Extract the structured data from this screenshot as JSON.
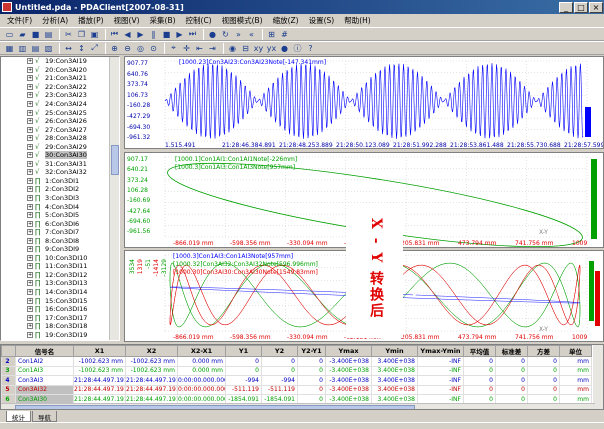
{
  "window": {
    "title": "Untitled.pda - PDAClient[2007-08-31]",
    "min": "_",
    "max": "□",
    "close": "×"
  },
  "menu": [
    "文件(F)",
    "分析(A)",
    "播放(P)",
    "视图(V)",
    "采集(B)",
    "控制(C)",
    "视图模式(B)",
    "缩放(Z)",
    "设置(S)",
    "帮助(H)"
  ],
  "tree": [
    {
      "label": "19:Con3AI19",
      "type": "analog"
    },
    {
      "label": "20:Con3AI20",
      "type": "analog"
    },
    {
      "label": "21:Con3AI21",
      "type": "analog"
    },
    {
      "label": "22:Con3AI22",
      "type": "analog"
    },
    {
      "label": "23:Con3AI23",
      "type": "analog"
    },
    {
      "label": "24:Con3AI24",
      "type": "analog"
    },
    {
      "label": "25:Con3AI25",
      "type": "analog"
    },
    {
      "label": "26:Con3AI26",
      "type": "analog"
    },
    {
      "label": "27:Con3AI27",
      "type": "analog"
    },
    {
      "label": "28:Con3AI28",
      "type": "analog"
    },
    {
      "label": "29:Con3AI29",
      "type": "analog"
    },
    {
      "label": "30:Con3AI30",
      "type": "analog",
      "selected": true
    },
    {
      "label": "31:Con3AI31",
      "type": "analog"
    },
    {
      "label": "32:Con3AI32",
      "type": "analog"
    },
    {
      "label": "1:Con3DI1",
      "type": "digital"
    },
    {
      "label": "2:Con3DI2",
      "type": "digital"
    },
    {
      "label": "3:Con3DI3",
      "type": "digital"
    },
    {
      "label": "4:Con3DI4",
      "type": "digital"
    },
    {
      "label": "5:Con3DI5",
      "type": "digital"
    },
    {
      "label": "6:Con3DI6",
      "type": "digital"
    },
    {
      "label": "7:Con3DI7",
      "type": "digital"
    },
    {
      "label": "8:Con3DI8",
      "type": "digital"
    },
    {
      "label": "9:Con3DI9",
      "type": "digital"
    },
    {
      "label": "10:Con3DI10",
      "type": "digital"
    },
    {
      "label": "11:Con3DI11",
      "type": "digital"
    },
    {
      "label": "12:Con3DI12",
      "type": "digital"
    },
    {
      "label": "13:Con3DI13",
      "type": "digital"
    },
    {
      "label": "14:Con3DI14",
      "type": "digital"
    },
    {
      "label": "15:Con3DI15",
      "type": "digital"
    },
    {
      "label": "16:Con3DI16",
      "type": "digital"
    },
    {
      "label": "17:Con3DI17",
      "type": "digital"
    },
    {
      "label": "18:Con3DI18",
      "type": "digital"
    },
    {
      "label": "19:Con3DI19",
      "type": "digital"
    }
  ],
  "panel1": {
    "legend": "[1000.23]Con3AI23:Con3AI23Note[-147.341mm]",
    "yticks": [
      "907.77",
      "640.76",
      "373.74",
      "106.73",
      "-160.28",
      "-427.29",
      "-694.30",
      "-961.32"
    ],
    "xticks": [
      "1.515.491",
      "21:28:46.384.891",
      "21:28:48.253.889",
      "21:28:50.123.089",
      "21:28:51.992.288",
      "21:28:53.861.488",
      "21:28:55.730.688",
      "21:28:57.599.888"
    ]
  },
  "panel2": {
    "legend1": "[1000.1]Con1AI1:Con1AI1Note[-226mm]",
    "legend2": "[1000.3]Con1AI3:Con1AI3Note[957mm]",
    "yticks": [
      "907.17",
      "640.21",
      "373.24",
      "106.28",
      "-160.69",
      "-427.64",
      "-694.60",
      "-961.56"
    ],
    "xticks": [
      "-866.019 mm",
      "-598.356 mm",
      "-330.094 mm",
      "-62.131 mm",
      "205.831 mm",
      "473.794 mm",
      "741.756 mm",
      "1009"
    ],
    "xy_label": "X-Y"
  },
  "panel3": {
    "legend1": "[1000.3]Con1AI3:Con1AI3Note[957mm]",
    "legend2": "[1000.32]Con3AI32:Con3AI32Note[596.996mm]",
    "legend3": "[1000.30]Con3AI30:Con3AI30Note[1549.83mm]",
    "ylabels": [
      "3534",
      "1319",
      "-51",
      "-1414",
      "-3129"
    ],
    "xticks": [
      "-866.019 mm",
      "-598.356 mm",
      "-330.094 mm",
      "-62.131 mm",
      "205.831 mm",
      "473.794 mm",
      "741.756 mm",
      "1009"
    ],
    "xy_label": "X-Y"
  },
  "annotation": "X - Y 转换后",
  "stats": {
    "headers": [
      "",
      "信号名",
      "X1",
      "X2",
      "X2-X1",
      "Y1",
      "Y2",
      "Y2-Y1",
      "Ymax",
      "Ymin",
      "Ymax-Ymin",
      "平均值",
      "标准差",
      "方差",
      "单位"
    ],
    "rows": [
      [
        "2",
        "Con1AI2",
        "-1002.623 mm",
        "-1002.623 mm",
        "0.000 mm",
        "0",
        "0",
        "0",
        "-3.400E+038",
        "3.400E+038",
        "-INF",
        "0",
        "0",
        "0",
        "mm"
      ],
      [
        "3",
        "Con1AI3",
        "-1002.623 mm",
        "-1002.623 mm",
        "0.000 mm",
        "0",
        "0",
        "0",
        "-3.400E+038",
        "3.400E+038",
        "-INF",
        "0",
        "0",
        "0",
        "mm"
      ],
      [
        "4",
        "Con3AI3",
        "21:28:44.497.191",
        "21:28:44.497.191",
        "0:00:00.000.000",
        "-994",
        "-994",
        "0",
        "-3.400E+038",
        "3.400E+038",
        "-INF",
        "0",
        "0",
        "0",
        "mm"
      ],
      [
        "5",
        "Con3AI32",
        "21:28:44.497.191",
        "21:28:44.497.191",
        "0:00:00.000.000",
        "-511.119",
        "-511.119",
        "0",
        "-3.400E+038",
        "3.400E+038",
        "-INF",
        "0",
        "0",
        "0",
        "mm"
      ],
      [
        "6",
        "Con3AI30",
        "21:28:44.497.191",
        "21:28:44.497.191",
        "0:00:00.000.000",
        "-1854.091",
        "-1854.091",
        "0",
        "-3.400E+038",
        "3.400E+038",
        "-INF",
        "0",
        "0",
        "0",
        "mm"
      ]
    ]
  },
  "tabs": [
    "统计",
    "导航"
  ],
  "colors": {
    "blue": "#0000ff",
    "green": "#00a000",
    "red": "#e00000",
    "titlebar": "#0a246a"
  }
}
